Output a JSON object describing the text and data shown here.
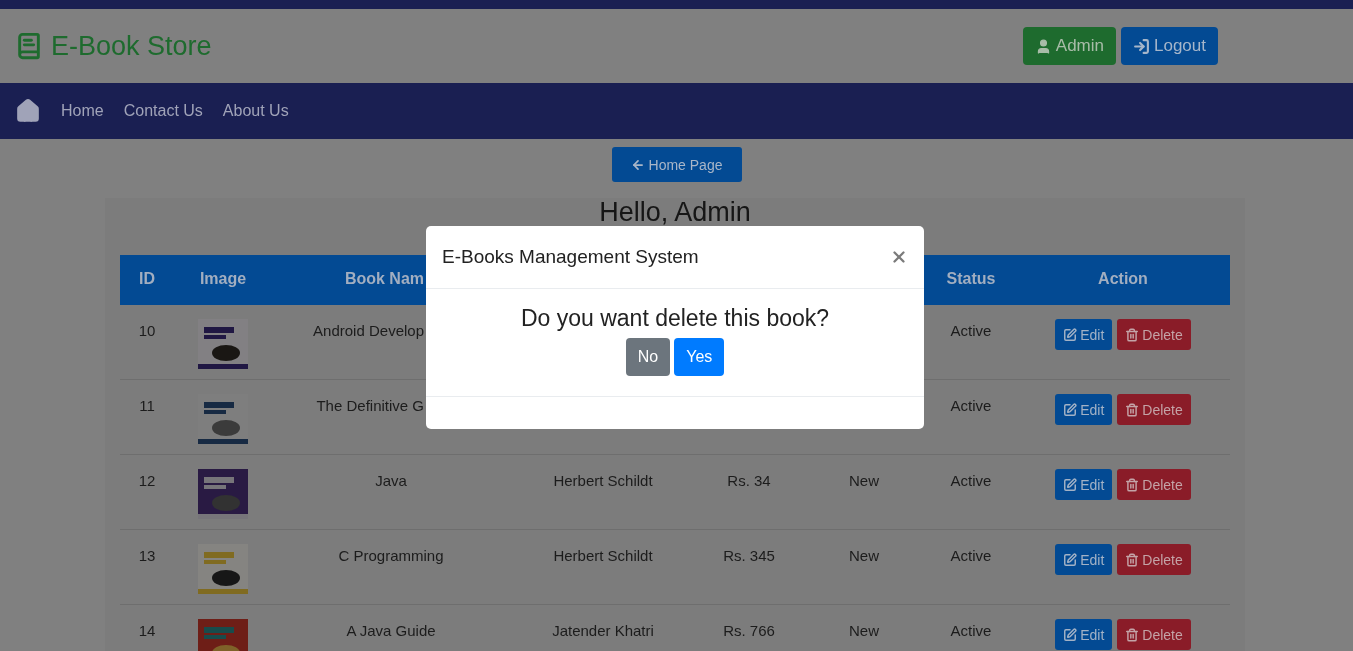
{
  "header": {
    "brand": "E-Book Store",
    "buttons": [
      {
        "label": "Admin",
        "kind": "user"
      },
      {
        "label": "Logout",
        "kind": "logout"
      }
    ]
  },
  "nav": {
    "items": [
      "Home",
      "Contact Us",
      "About Us"
    ]
  },
  "back_button": "Home Page",
  "heading": "Hello, Admin",
  "table": {
    "columns": {
      "id": "ID",
      "image": "Image",
      "book_name": "Book Nam",
      "status": "Status",
      "action": "Action"
    },
    "book_name_cut_off": true,
    "rows": [
      {
        "id": "10",
        "book_name": "Android Develop",
        "cut_off": true,
        "status": "Active",
        "edit": "Edit",
        "delete": "Delete"
      },
      {
        "id": "11",
        "book_name": "The Definitive G",
        "cut_off": true,
        "status": "Active",
        "edit": "Edit",
        "delete": "Delete"
      },
      {
        "id": "12",
        "book_name": "Java",
        "author": "Herbert Schildt",
        "price": "Rs. 34",
        "category": "New",
        "status": "Active",
        "edit": "Edit",
        "delete": "Delete"
      },
      {
        "id": "13",
        "book_name": "C Programming",
        "author": "Herbert Schildt",
        "price": "Rs. 345",
        "category": "New",
        "status": "Active",
        "edit": "Edit",
        "delete": "Delete"
      },
      {
        "id": "14",
        "book_name": "A Java Guide",
        "author": "Jatender Khatri",
        "price": "Rs. 766",
        "category": "New",
        "status": "Active",
        "edit": "Edit",
        "delete": "Delete"
      }
    ]
  },
  "modal": {
    "title": "E-Books Management System",
    "message": "Do you want delete this book?",
    "buttons": [
      {
        "label": "No",
        "kind": "secondary"
      },
      {
        "label": "Yes",
        "kind": "primary"
      }
    ]
  }
}
